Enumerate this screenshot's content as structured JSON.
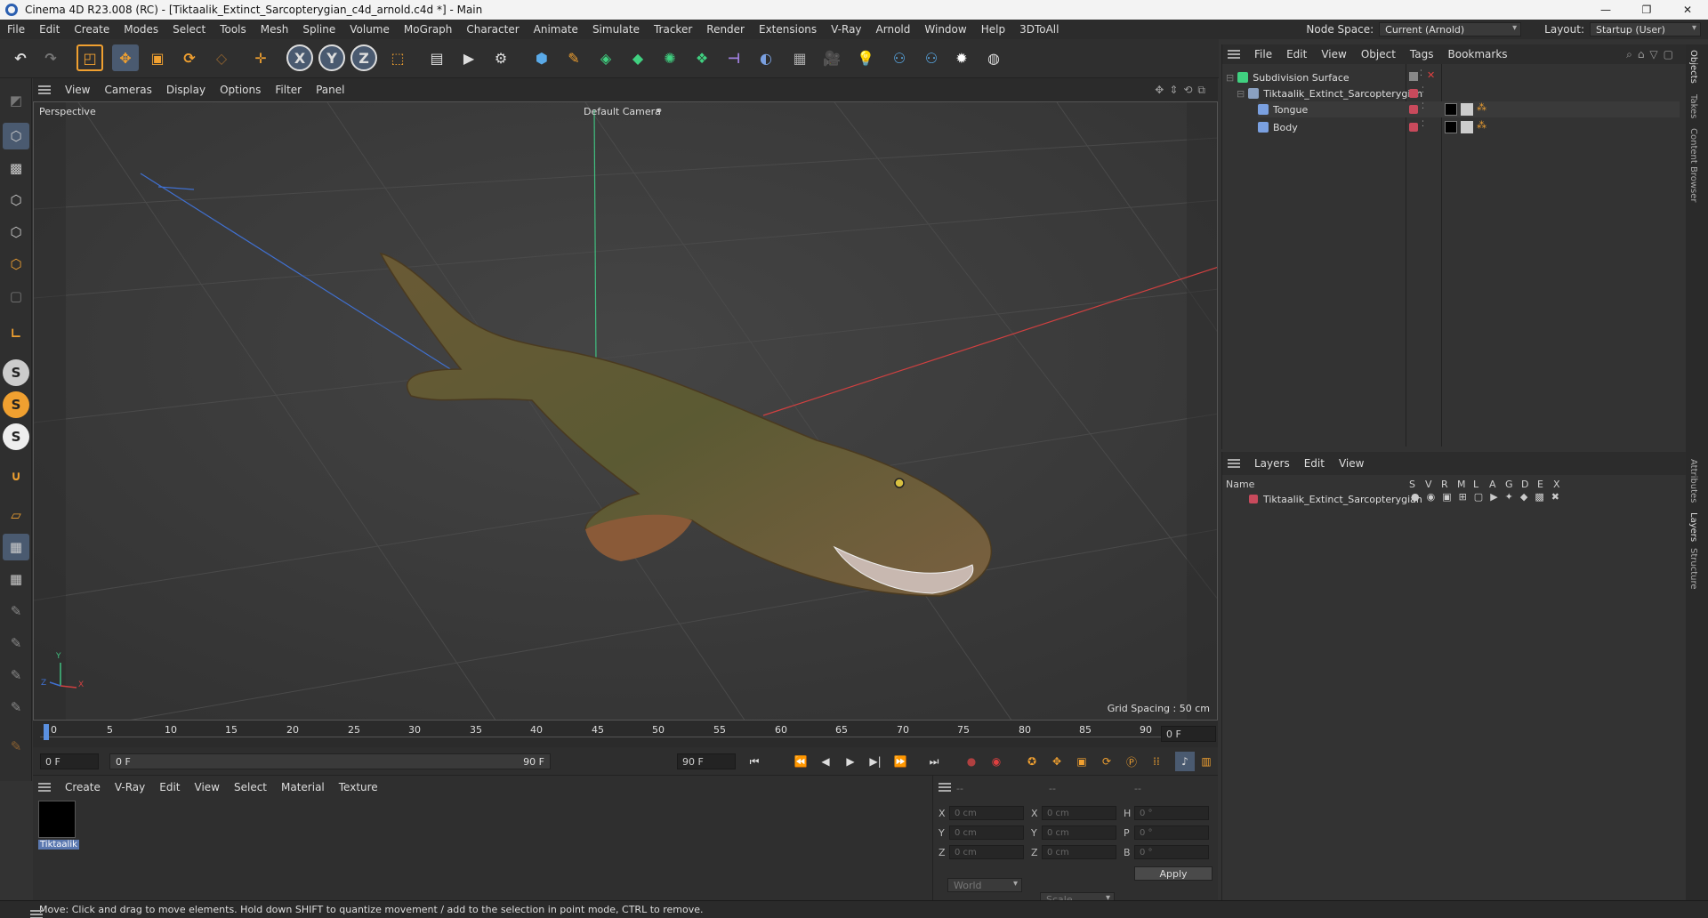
{
  "window": {
    "title": "Cinema 4D R23.008 (RC) - [Tiktaalik_Extinct_Sarcopterygian_c4d_arnold.c4d *] - Main",
    "controls": [
      "—",
      "❐",
      "✕"
    ]
  },
  "menubar": {
    "items": [
      "File",
      "Edit",
      "Create",
      "Modes",
      "Select",
      "Tools",
      "Mesh",
      "Spline",
      "Volume",
      "MoGraph",
      "Character",
      "Animate",
      "Simulate",
      "Tracker",
      "Render",
      "Extensions",
      "V-Ray",
      "Arnold",
      "Window",
      "Help",
      "3DToAll"
    ],
    "node_space_label": "Node Space:",
    "node_space_value": "Current (Arnold)",
    "layout_label": "Layout:",
    "layout_value": "Startup (User)"
  },
  "viewport": {
    "menu": [
      "View",
      "Cameras",
      "Display",
      "Options",
      "Filter",
      "Panel"
    ],
    "view_name": "Perspective",
    "camera_name": "Default Camera",
    "grid_spacing": "Grid Spacing : 50 cm",
    "axis_labels": {
      "y": "Y",
      "z": "Z",
      "x": "X"
    }
  },
  "timeline": {
    "ticks": [
      "0",
      "5",
      "10",
      "15",
      "20",
      "25",
      "30",
      "35",
      "40",
      "45",
      "50",
      "55",
      "60",
      "65",
      "70",
      "75",
      "80",
      "85",
      "90"
    ],
    "current_frame": "0 F",
    "start_frame": "0 F",
    "range_start": "0 F",
    "range_end": "90 F",
    "end_frame": "90 F"
  },
  "material_manager": {
    "menu": [
      "Create",
      "V-Ray",
      "Edit",
      "View",
      "Select",
      "Material",
      "Texture"
    ],
    "materials": [
      {
        "name": "Tiktaalik"
      }
    ]
  },
  "coordinates": {
    "headers": [
      "--",
      "--",
      "--"
    ],
    "rows": [
      {
        "a": "X",
        "av": "0 cm",
        "b": "X",
        "bv": "0 cm",
        "c": "H",
        "cv": "0 °"
      },
      {
        "a": "Y",
        "av": "0 cm",
        "b": "Y",
        "bv": "0 cm",
        "c": "P",
        "cv": "0 °"
      },
      {
        "a": "Z",
        "av": "0 cm",
        "b": "Z",
        "bv": "0 cm",
        "c": "B",
        "cv": "0 °"
      }
    ],
    "coord_system": "World",
    "mode": "Scale",
    "apply": "Apply"
  },
  "objects_panel": {
    "menu": [
      "File",
      "Edit",
      "View",
      "Object",
      "Tags",
      "Bookmarks"
    ],
    "items": [
      {
        "name": "Subdivision Surface",
        "indent": 0
      },
      {
        "name": "Tiktaalik_Extinct_Sarcopterygian",
        "indent": 1
      },
      {
        "name": "Tongue",
        "indent": 2
      },
      {
        "name": "Body",
        "indent": 2
      }
    ]
  },
  "layers_panel": {
    "menu": [
      "Layers",
      "Edit",
      "View"
    ],
    "col_name": "Name",
    "columns": [
      "S",
      "V",
      "R",
      "M",
      "L",
      "A",
      "G",
      "D",
      "E",
      "X"
    ],
    "layers": [
      {
        "name": "Tiktaalik_Extinct_Sarcopterygian",
        "color": "#c84a5c"
      }
    ]
  },
  "side_tabs": [
    "Objects",
    "Takes",
    "Content Browser",
    "Attributes",
    "Layers",
    "Structure"
  ],
  "status": "Move: Click and drag to move elements. Hold down SHIFT to quantize movement / add to the selection in point mode, CTRL to remove.",
  "colors": {
    "accent": "#f0a030",
    "axis_x": "#d04040",
    "axis_y": "#40c080",
    "axis_z": "#4070d0"
  }
}
